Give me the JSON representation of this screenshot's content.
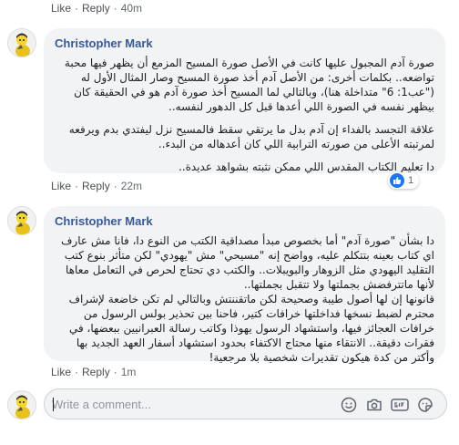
{
  "comment_labels": {
    "like": "Like",
    "reply": "Reply",
    "separator": "·"
  },
  "prev_comment": {
    "time": "40m"
  },
  "comments": [
    {
      "author": "Christopher Mark",
      "paragraphs": [
        "صورة آدم المجبول عليها كانت في الأصل صورة المسيح المزمع أن يظهر فيها محبة تواضعه.. بكلمات أخرى: من الأصل آدم أخذ صورة المسيح وصار المثال الأول له (\"عب1: 6\" متداخلة هنا)، وبالتالي لما المسيح أخذ صورة آدم هو في الحقيقة كان بيظهر نفسه في الصورة اللي أعدها قبل كل الدهور لنفسه..",
        "علاقة التجسد بالفداء إن آدم بدل ما يرتقي سقط فالمسيح نزل ليفتدي بدم ويرفعه لمرتبته الأعلى من صورته الترابية اللي كان أعدهاله من البدء..",
        "دا تعليم الكتاب المقدس اللي ممكن نثبته بشواهد عديدة.."
      ],
      "time": "22m",
      "reaction_count": "1"
    },
    {
      "author": "Christopher Mark",
      "paragraphs": [
        "دا بشأن \"صورة آدم\" أما بخصوص مبدأ مصداقية الكتب من النوع دا، فانا مش عارف اي كتاب بعينه بتتكلم عليه، وواضح إنه \"مسيحي\" مش \"يهودي\" لكن متأثر بنوع كتب التقليد اليهودي مثل الزوهار والبويبلات.. والكتب دي تحتاج لحرص في التعامل معاها لأنها ماتترفضش بجملتها ولا تتقبل بجملتها..",
        "قانونها إن لها أصول طيبة وصحيحة لكن ماتقننتش وبالتالي لم تكن خاضعة لإشراف محترم لضبط نسخها فداخلتها خرافات كتير، فاحنا بين تحذير بولس الرسول من خرافات العجائز فيها، واستشهاد الرسول يهوذا وكاتب رسالة العبرانيين ببعضها، في فقرات دقيقة.. الانتقاء منها محتاج الاكتفاء بحدود استشهاد أسفار العهد الجديد بها وأكتر من كدة هيكون تقديرات شخصية بلا مرجعية!"
      ],
      "time": "1m"
    }
  ],
  "composer": {
    "placeholder": "Write a comment..."
  },
  "colors": {
    "author": "#385898",
    "bubble": "#f2f3f5",
    "link": "#4b4f56",
    "like_badge": "#1877f2"
  },
  "icons": [
    "avatar-drawing",
    "like-icon",
    "emoji-icon",
    "camera-icon",
    "gif-icon",
    "sticker-icon"
  ]
}
